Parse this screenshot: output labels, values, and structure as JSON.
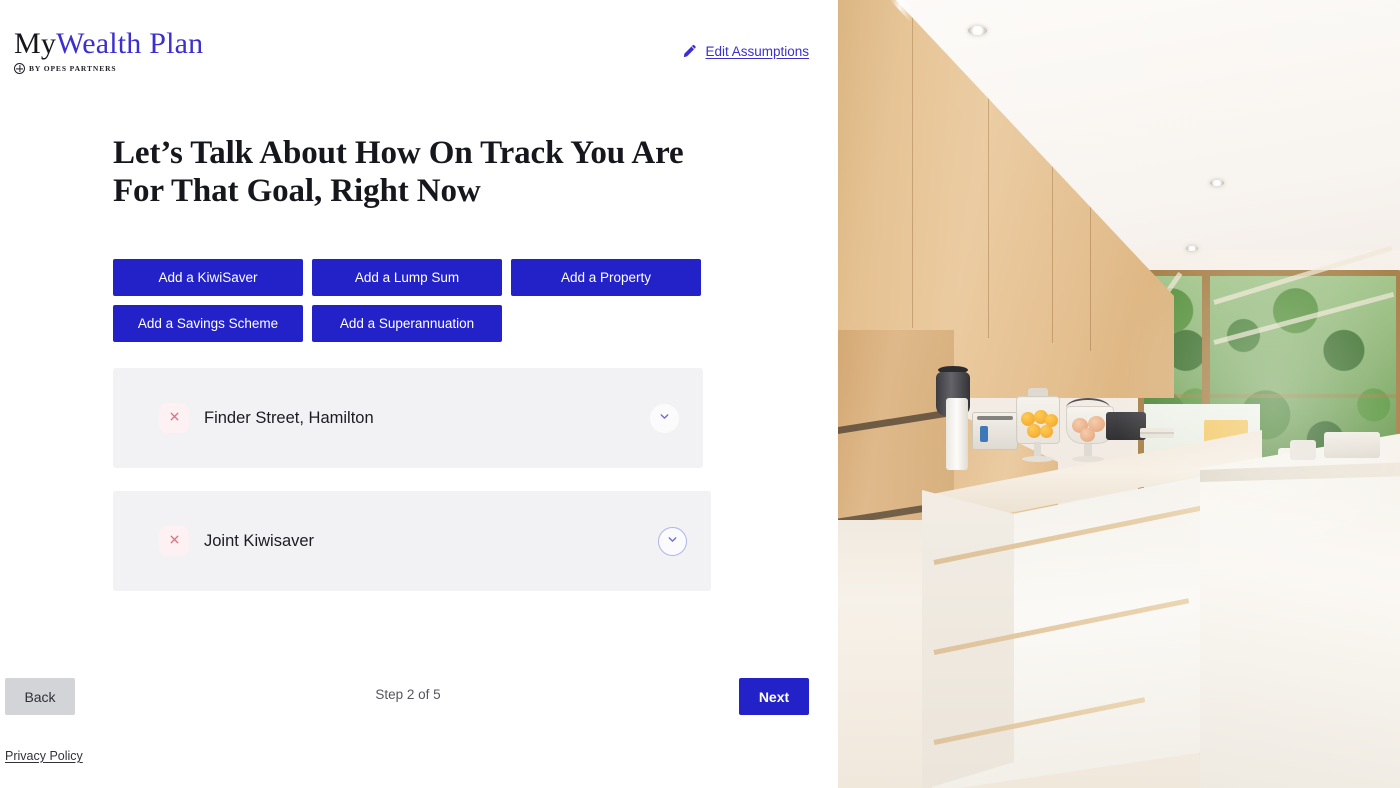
{
  "brand": {
    "logo_part1": "My",
    "logo_part2": "Wealth Plan",
    "logo_subtitle": "BY OPES PARTNERS",
    "accent_blue": "#2322c9",
    "logo_blue": "#3b2fcf"
  },
  "header": {
    "edit_assumptions_label": "Edit Assumptions",
    "pencil_icon": "pencil-icon"
  },
  "main": {
    "headline": "Let’s Talk About How On Track You Are For That Goal, Right Now",
    "action_buttons": [
      {
        "label": "Add a KiwiSaver",
        "name": "add-kiwisaver-button"
      },
      {
        "label": "Add a Lump Sum",
        "name": "add-lump-sum-button"
      },
      {
        "label": "Add a Property",
        "name": "add-property-button"
      },
      {
        "label": "Add a Savings Scheme",
        "name": "add-savings-scheme-button"
      },
      {
        "label": "Add a Superannuation",
        "name": "add-superannuation-button"
      }
    ],
    "assets": [
      {
        "label": "Finder Street, Hamilton",
        "remove_icon": "close-x-icon",
        "expand_icon": "chevron-down-icon",
        "expanded": false,
        "focused": false
      },
      {
        "label": "Joint Kiwisaver",
        "remove_icon": "close-x-icon",
        "expand_icon": "chevron-down-icon",
        "expanded": false,
        "focused": true
      }
    ]
  },
  "footer": {
    "back_label": "Back",
    "step_label": "Step 2 of 5",
    "next_label": "Next",
    "privacy_label": "Privacy Policy"
  },
  "side_image": {
    "alt": "Modern kitchen interior with light oak cabinetry, white glossy drawers, tiled floor and glass doors opening to a garden patio"
  }
}
